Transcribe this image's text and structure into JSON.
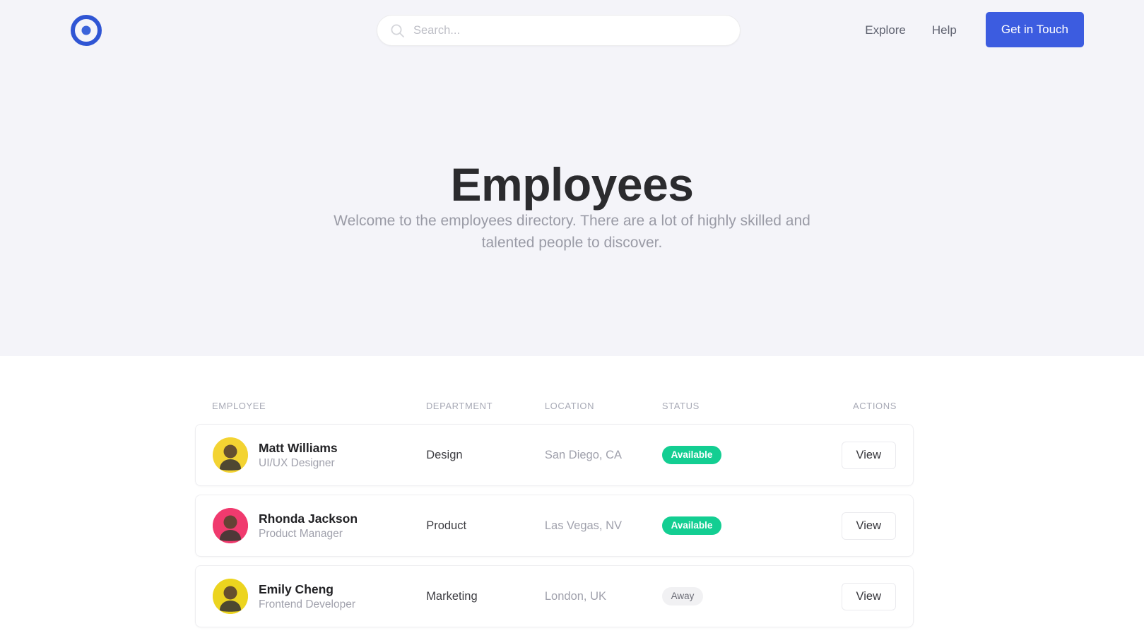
{
  "brand": {
    "logo_icon": "target-circle-logo",
    "accent_color": "#3c5ce0"
  },
  "header": {
    "search": {
      "placeholder": "Search...",
      "value": "",
      "icon": "search-icon"
    },
    "nav": {
      "explore": "Explore",
      "help": "Help",
      "cta": "Get in Touch"
    }
  },
  "hero": {
    "title": "Employees",
    "subtitle": "Welcome to the employees directory. There are a lot of highly skilled and talented people to discover.",
    "background_color": "#f4f4f9"
  },
  "table": {
    "headers": {
      "employee": "EMPLOYEE",
      "department": "DEPARTMENT",
      "location": "LOCATION",
      "status": "STATUS",
      "actions": "ACTIONS"
    },
    "action_label": "View",
    "rows": [
      {
        "name": "Matt Williams",
        "role": "UI/UX Designer",
        "department": "Design",
        "location": "San Diego, CA",
        "status": "Available",
        "status_type": "available",
        "action": "View",
        "avatar_color": "#f3d332"
      },
      {
        "name": "Rhonda Jackson",
        "role": "Product Manager",
        "department": "Product",
        "location": "Las Vegas, NV",
        "status": "Available",
        "status_type": "available",
        "action": "View",
        "avatar_color": "#f03a6e"
      },
      {
        "name": "Emily Cheng",
        "role": "Frontend Developer",
        "department": "Marketing",
        "location": "London, UK",
        "status": "Away",
        "status_type": "away",
        "action": "View",
        "avatar_color": "#ecd41f"
      }
    ]
  },
  "colors": {
    "status_available": "#13ce92",
    "status_away": "#f1f1f3"
  }
}
